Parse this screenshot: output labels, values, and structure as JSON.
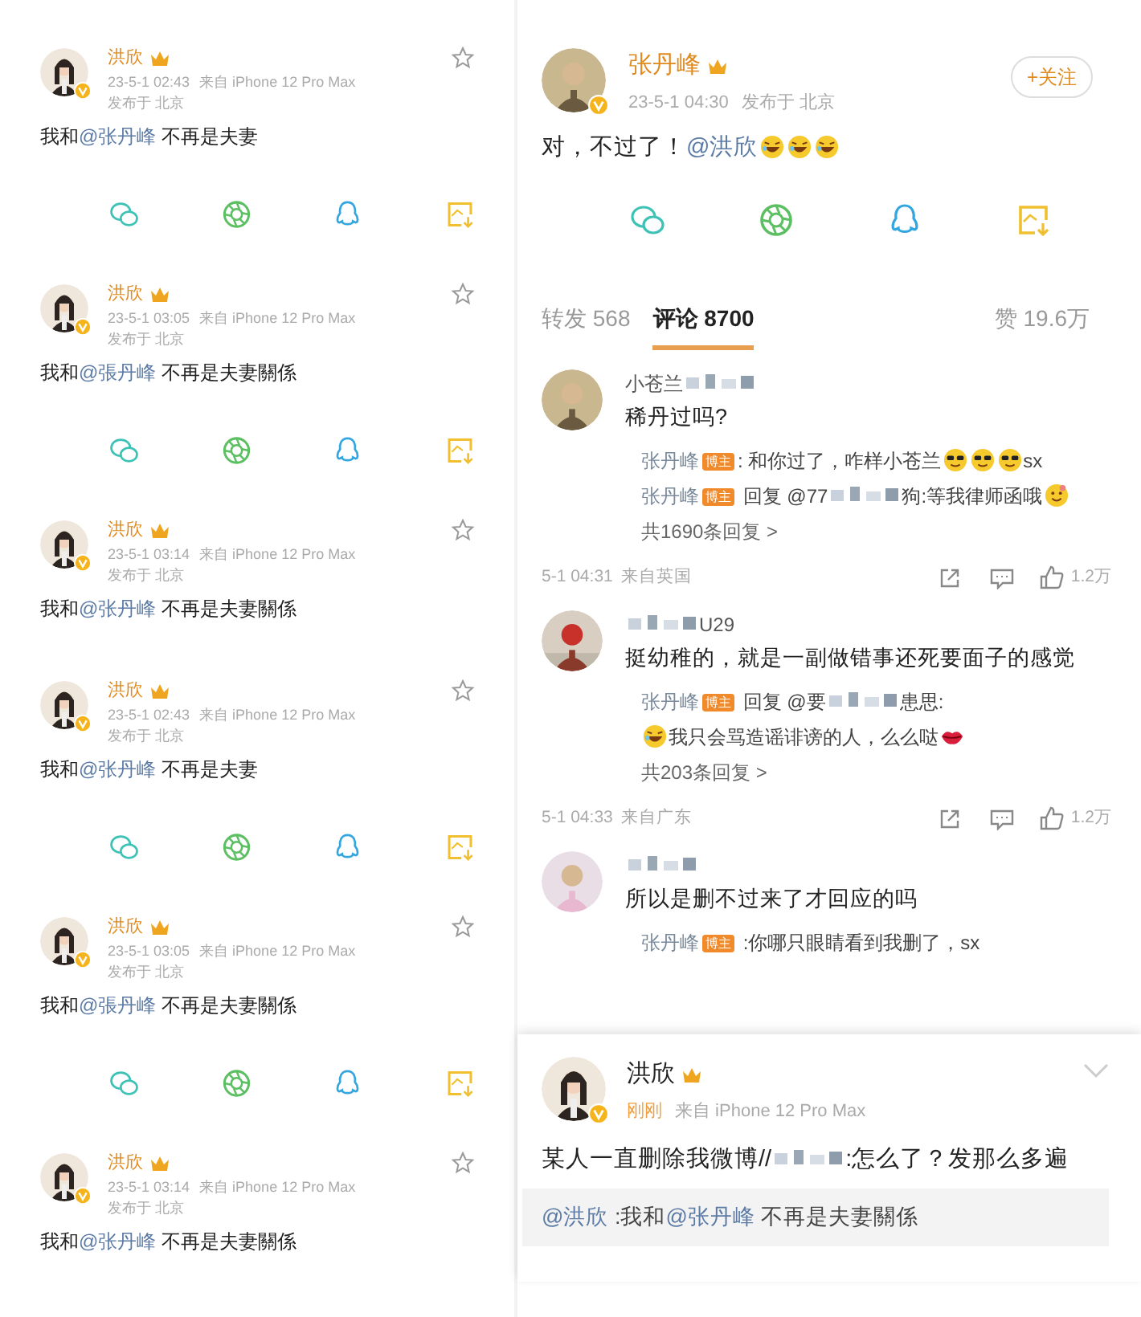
{
  "left_posts": [
    {
      "author": "洪欣",
      "time": "23-5-1 02:43",
      "source": "来自 iPhone 12 Pro Max",
      "location": "发布于 北京",
      "body": [
        {
          "kind": "plain",
          "text": "我和"
        },
        {
          "kind": "mention",
          "text": "@张丹峰"
        },
        {
          "kind": "plain",
          "text": " 不再是夫妻"
        }
      ],
      "share_row": true
    },
    {
      "author": "洪欣",
      "time": "23-5-1 03:05",
      "source": "来自 iPhone 12 Pro Max",
      "location": "发布于 北京",
      "body": [
        {
          "kind": "plain",
          "text": "我和"
        },
        {
          "kind": "mention",
          "text": "@張丹峰"
        },
        {
          "kind": "plain",
          "text": " 不再是夫妻關係"
        }
      ],
      "share_row": true
    },
    {
      "author": "洪欣",
      "time": "23-5-1 03:14",
      "source": "来自 iPhone 12 Pro Max",
      "location": "发布于 北京",
      "body": [
        {
          "kind": "plain",
          "text": "我和"
        },
        {
          "kind": "mention",
          "text": "@张丹峰"
        },
        {
          "kind": "plain",
          "text": " 不再是夫妻關係"
        }
      ],
      "share_row": false
    },
    {
      "author": "洪欣",
      "time": "23-5-1 02:43",
      "source": "来自 iPhone 12 Pro Max",
      "location": "发布于 北京",
      "body": [
        {
          "kind": "plain",
          "text": "我和"
        },
        {
          "kind": "mention",
          "text": "@张丹峰"
        },
        {
          "kind": "plain",
          "text": " 不再是夫妻"
        }
      ],
      "share_row": true
    },
    {
      "author": "洪欣",
      "time": "23-5-1 03:05",
      "source": "来自 iPhone 12 Pro Max",
      "location": "发布于 北京",
      "body": [
        {
          "kind": "plain",
          "text": "我和"
        },
        {
          "kind": "mention",
          "text": "@張丹峰"
        },
        {
          "kind": "plain",
          "text": " 不再是夫妻關係"
        }
      ],
      "share_row": true
    },
    {
      "author": "洪欣",
      "time": "23-5-1 03:14",
      "source": "来自 iPhone 12 Pro Max",
      "location": "发布于 北京",
      "body": [
        {
          "kind": "plain",
          "text": "我和"
        },
        {
          "kind": "mention",
          "text": "@张丹峰"
        },
        {
          "kind": "plain",
          "text": " 不再是夫妻關係"
        }
      ],
      "share_row": false
    }
  ],
  "main_post": {
    "author": "张丹峰",
    "time": "23-5-1 04:30",
    "location": "发布于 北京",
    "follow": "+关注",
    "body": [
      {
        "kind": "plain",
        "text": "对，不过了！"
      },
      {
        "kind": "mention",
        "text": "@洪欣"
      },
      {
        "kind": "laugh"
      },
      {
        "kind": "laugh"
      },
      {
        "kind": "laugh"
      }
    ]
  },
  "tabs": [
    {
      "label": "转发 568",
      "selected": false
    },
    {
      "label": "评论 8700",
      "selected": true
    },
    {
      "label": "赞 19.6万",
      "selected": false
    }
  ],
  "comments": [
    {
      "name": [
        {
          "kind": "plain",
          "text": "小苍兰"
        },
        {
          "kind": "blur"
        }
      ],
      "body": "稀丹过吗?",
      "replies": [
        {
          "author": "张丹峰",
          "badge": "博主",
          "segments": [
            {
              "kind": "plain",
              "text": ": 和你过了，咋样小苍兰"
            },
            {
              "kind": "cool"
            },
            {
              "kind": "cool"
            },
            {
              "kind": "cool"
            },
            {
              "kind": "plain",
              "text": "sx"
            }
          ]
        },
        {
          "author": "张丹峰",
          "badge": "博主",
          "segments": [
            {
              "kind": "plain",
              "text": " 回复 @77"
            },
            {
              "kind": "blur"
            },
            {
              "kind": "plain",
              "text": "狗:等我律师函哦"
            },
            {
              "kind": "smile"
            }
          ]
        }
      ],
      "more": "共1690条回复 >",
      "time": "5-1 04:31",
      "location": "来自英国",
      "likes": "1.2万"
    },
    {
      "name": [
        {
          "kind": "blur"
        },
        {
          "kind": "plain",
          "text": "U29"
        }
      ],
      "body": "挺幼稚的，就是一副做错事还死要面子的感觉",
      "replies": [
        {
          "author": "张丹峰",
          "badge": "博主",
          "segments": [
            {
              "kind": "plain",
              "text": " 回复 @要"
            },
            {
              "kind": "blur"
            },
            {
              "kind": "plain",
              "text": "患思:"
            }
          ],
          "continuation": [
            {
              "kind": "laugh"
            },
            {
              "kind": "plain",
              "text": "我只会骂造谣诽谤的人，么么哒"
            },
            {
              "kind": "lips"
            }
          ]
        }
      ],
      "more": "共203条回复 >",
      "time": "5-1 04:33",
      "location": "来自广东",
      "likes": "1.2万"
    },
    {
      "name": [
        {
          "kind": "blur"
        }
      ],
      "body": "所以是删不过来了才回应的吗",
      "replies": [
        {
          "author": "张丹峰",
          "badge": "博主",
          "segments": [
            {
              "kind": "plain",
              "text": " :你哪只眼睛看到我删了，sx"
            }
          ]
        }
      ]
    }
  ],
  "repost_card": {
    "author": "洪欣",
    "time": "刚刚",
    "source": "来自 iPhone 12 Pro Max",
    "body": [
      {
        "kind": "plain",
        "text": "某人一直删除我微博//"
      },
      {
        "kind": "blur"
      },
      {
        "kind": "plain",
        "text": ":怎么了？发那么多遍"
      }
    ],
    "quote": [
      {
        "kind": "mention",
        "text": "@洪欣"
      },
      {
        "kind": "plain",
        "text": " :我和"
      },
      {
        "kind": "mention",
        "text": "@张丹峰"
      },
      {
        "kind": "plain",
        "text": " 不再是夫妻關係"
      }
    ]
  }
}
